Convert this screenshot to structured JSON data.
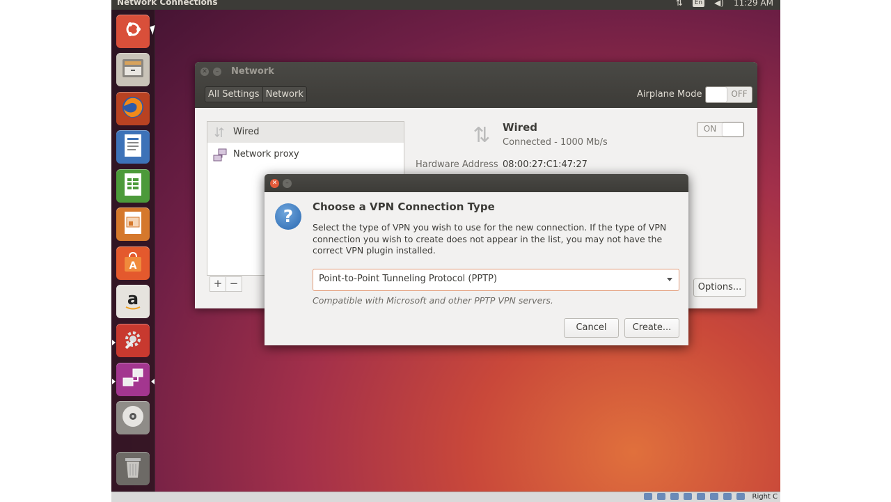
{
  "top_panel": {
    "title": "Network Connections",
    "keyboard_indicator": "En",
    "clock": "11:29 AM"
  },
  "launcher": {
    "items": [
      {
        "name": "dash-home",
        "icon": "ubuntu-logo-icon",
        "color": "#d94f3a"
      },
      {
        "name": "files",
        "icon": "file-cabinet-icon",
        "color": "#c9c3b8"
      },
      {
        "name": "firefox",
        "icon": "firefox-icon",
        "color": "#e66a1f"
      },
      {
        "name": "writer",
        "icon": "document-icon",
        "color": "#3d72b8"
      },
      {
        "name": "calc",
        "icon": "spreadsheet-icon",
        "color": "#4c9a3a"
      },
      {
        "name": "impress",
        "icon": "presentation-icon",
        "color": "#d5782c"
      },
      {
        "name": "software-center",
        "icon": "shopping-bag-icon",
        "color": "#e4592d"
      },
      {
        "name": "amazon",
        "icon": "amazon-icon",
        "color": "#d9d6d1"
      },
      {
        "name": "system-settings",
        "icon": "settings-wrench-icon",
        "color": "#c8392f"
      },
      {
        "name": "network-connections",
        "icon": "network-icon",
        "color": "#a3368f"
      },
      {
        "name": "dvd",
        "icon": "disc-icon",
        "color": "#bcbab5"
      },
      {
        "name": "trash",
        "icon": "trash-icon",
        "color": "#8c8a86"
      }
    ]
  },
  "network_window": {
    "title": "Network",
    "breadcrumbs": [
      "All Settings",
      "Network"
    ],
    "airplane_mode": {
      "label": "Airplane Mode",
      "state": "OFF"
    },
    "list": [
      {
        "label": "Wired",
        "icon": "wired-icon"
      },
      {
        "label": "Network proxy",
        "icon": "network-proxy-icon"
      }
    ],
    "add_label": "+",
    "remove_label": "−",
    "wired": {
      "name": "Wired",
      "status": "Connected - 1000 Mb/s",
      "toggle": "ON",
      "hw_label": "Hardware Address",
      "hw_value": "08:00:27:C1:47:27"
    },
    "options_label": "Options..."
  },
  "vpn_dialog": {
    "heading": "Choose a VPN Connection Type",
    "description": "Select the type of VPN you wish to use for the new connection.  If the type of VPN connection you wish to create does not appear in the list, you may not have the correct VPN plugin installed.",
    "selected_type": "Point-to-Point Tunneling Protocol (PPTP)",
    "compat_note": "Compatible with Microsoft and other PPTP VPN servers.",
    "cancel_label": "Cancel",
    "create_label": "Create..."
  },
  "vm_status": {
    "right_text": "Right C"
  },
  "colors": {
    "panel": "#3c3b37",
    "accent_orange": "#e45a3a",
    "dialog_bg": "#f2f1f0"
  }
}
